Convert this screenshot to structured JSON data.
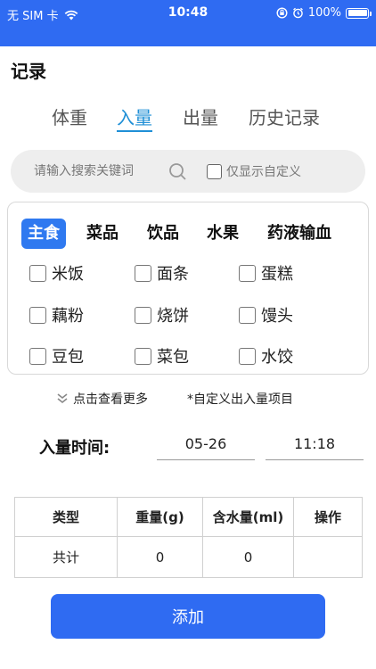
{
  "status_bar": {
    "carrier": "无 SIM 卡",
    "time": "10:48",
    "battery": "100%",
    "battery_level": 1.0
  },
  "page_title": "记录",
  "tabs": [
    {
      "label": "体重",
      "active": false
    },
    {
      "label": "入量",
      "active": true
    },
    {
      "label": "出量",
      "active": false
    },
    {
      "label": "历史记录",
      "active": false
    }
  ],
  "search": {
    "placeholder": "请输入搜索关键词",
    "custom_only_label": "仅显示自定义"
  },
  "categories": [
    "主食",
    "菜品",
    "饮品",
    "水果",
    "药液输血"
  ],
  "items": [
    "米饭",
    "面条",
    "蛋糕",
    "藕粉",
    "烧饼",
    "馒头",
    "豆包",
    "菜包",
    "水饺"
  ],
  "more_label": "点击查看更多",
  "custom_link": "*自定义出入量项目",
  "intake_time": {
    "label": "入量时间:",
    "date": "05-26",
    "time": "11:18"
  },
  "table": {
    "headers": [
      "类型",
      "重量(g)",
      "含水量(ml)",
      "操作"
    ],
    "total_row": [
      "共计",
      "0",
      "0",
      ""
    ]
  },
  "add_button": "添加",
  "colors": {
    "primary": "#2f6bf2",
    "tab_active": "#1f8fd6"
  }
}
